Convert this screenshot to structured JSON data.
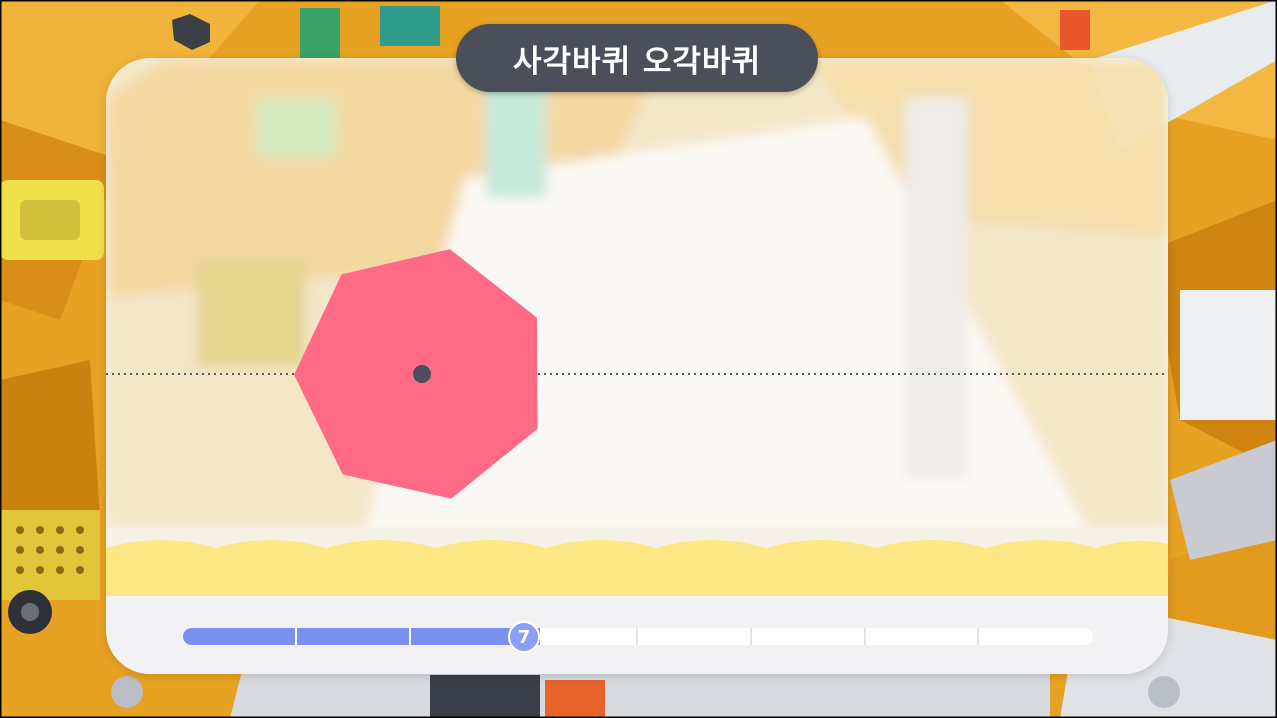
{
  "title": "사각바퀴 오각바퀴",
  "progress": {
    "current_step": 7,
    "knob_label": "7",
    "segments_total": 8,
    "segments_filled": 3
  },
  "shape": {
    "name": "heptagon-wheel",
    "sides": 7,
    "color": "#ff6b86",
    "center_color": "#4a4f5a"
  },
  "colors": {
    "ground": "#fde785",
    "title_bg": "#4a4f5a",
    "progress_fill": "#7b8ff0",
    "knob": "#8c9ef3"
  }
}
